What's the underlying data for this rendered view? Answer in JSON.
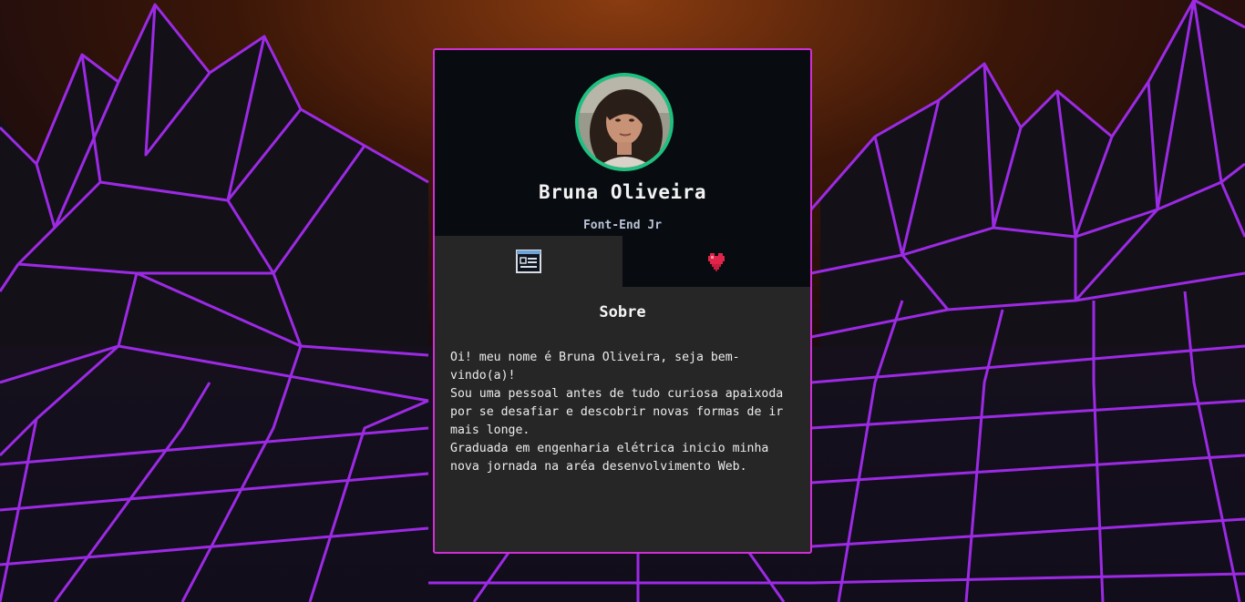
{
  "profile": {
    "name": "Bruna Oliveira",
    "role": "Font-End Jr",
    "avatar_icon": "profile-photo"
  },
  "tabs": [
    {
      "icon": "id-card-icon",
      "active": true
    },
    {
      "icon": "heart-icon",
      "active": false
    }
  ],
  "about": {
    "title": "Sobre",
    "paragraphs": [
      "Oi! meu nome é Bruna Oliveira, seja bem-vindo(a)!",
      "Sou uma pessoal antes de tudo curiosa apaixoda por se desafiar e descobrir novas formas de ir mais longe.",
      "Graduada em engenharia elétrica inicio minha nova jornada na aréa desenvolvimento Web."
    ]
  },
  "colors": {
    "card_border": "#d12fd6",
    "avatar_ring": "#1fc07f",
    "grid_line": "#a42cf0",
    "header_bg": "#080c11",
    "body_bg": "#262626",
    "heart": "#e0254a"
  }
}
